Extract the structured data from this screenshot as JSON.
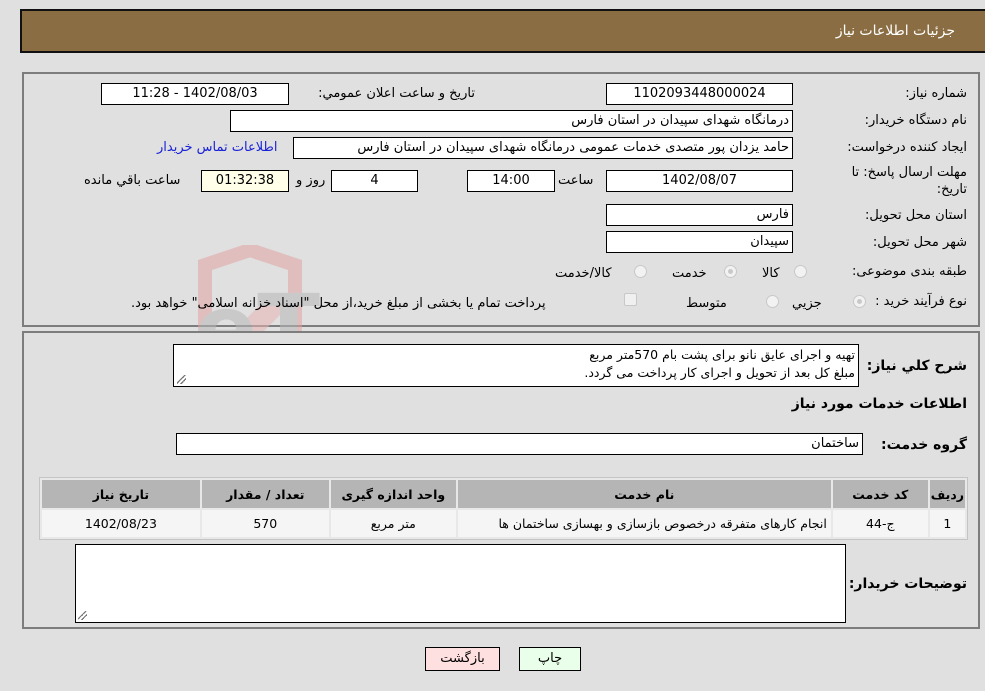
{
  "header": {
    "title": "جزئیات اطلاعات نیاز"
  },
  "form": {
    "need_number": {
      "label": "شماره نیاز:",
      "value": "1102093448000024"
    },
    "announce_datetime": {
      "label": "تاریخ و ساعت اعلان عمومي:",
      "value": "1402/08/03 - 11:28"
    },
    "buyer_org": {
      "label": "نام دستگاه خريدار:",
      "value": "درمانگاه شهدای سپیدان در استان فارس"
    },
    "requester": {
      "label": "ایجاد کننده درخواست:",
      "value": "حامد یزدان پور متصدی خدمات عمومی درمانگاه شهدای سپیدان در استان فارس",
      "contact_link": "اطلاعات تماس خریدار"
    },
    "deadline": {
      "label": "مهلت ارسال پاسخ: تا تاریخ:",
      "date": "1402/08/07",
      "time_label": "ساعت",
      "time": "14:00",
      "days": "4",
      "days_label": "روز و",
      "remaining": "01:32:38",
      "remaining_label": "ساعت باقي مانده"
    },
    "delivery_province": {
      "label": "استان محل تحویل:",
      "value": "فارس"
    },
    "delivery_city": {
      "label": "شهر محل تحویل:",
      "value": "سپیدان"
    },
    "category": {
      "label": "طبقه بندی موضوعی:",
      "options": [
        "کالا",
        "خدمت",
        "کالا/خدمت"
      ],
      "selected": "خدمت"
    },
    "purchase_type": {
      "label": "نوع فرآیند خرید :",
      "options": [
        "جزيي",
        "متوسط"
      ],
      "selected": "جزيي",
      "treasury_note": "پرداخت تمام یا بخشی از مبلغ خرید،از محل \"اسناد خزانه اسلامی\" خواهد بود."
    }
  },
  "description": {
    "label": "شرح کلي نياز:",
    "line1": "تهیه و اجرای عایق نانو برای پشت بام 570متر مربع",
    "line2": "مبلغ کل بعد از تحویل و اجرای کار پرداخت می گردد."
  },
  "services": {
    "section_title": "اطلاعات خدمات مورد نیاز",
    "group_label": "گروه خدمت:",
    "group_value": "ساختمان",
    "columns": [
      "ردیف",
      "کد خدمت",
      "نام خدمت",
      "واحد اندازه گیری",
      "تعداد / مقدار",
      "تاریخ نیاز"
    ],
    "rows": [
      {
        "row": "1",
        "code": "ج-44",
        "name": "انجام کارهای متفرقه درخصوص بازسازی و بهسازی ساختمان ها",
        "unit": "متر مربع",
        "qty": "570",
        "date": "1402/08/23"
      }
    ]
  },
  "buyer_notes": {
    "label": "توضیحات خریدار:",
    "value": ""
  },
  "buttons": {
    "print": "چاپ",
    "back": "بازگشت"
  },
  "watermark": {
    "text": "AriaTender.neT"
  },
  "colors": {
    "header_bg": "#8b6d43",
    "print_bg": "#eaffea",
    "back_bg": "#ffe0e0",
    "link": "#1a22d8"
  }
}
